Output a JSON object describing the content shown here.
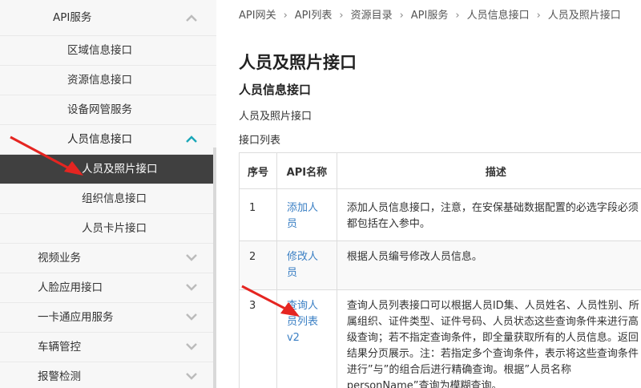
{
  "sidebar": {
    "items": [
      {
        "label": "API服务",
        "level": 2,
        "chevron": "chevron-up"
      },
      {
        "label": "区域信息接口",
        "level": 3
      },
      {
        "label": "资源信息接口",
        "level": 3
      },
      {
        "label": "设备网管服务",
        "level": 3
      },
      {
        "label": "人员信息接口",
        "level": 3,
        "chevron": "chevron-up",
        "open": true
      },
      {
        "label": "人员及照片接口",
        "level": 4,
        "active": true
      },
      {
        "label": "组织信息接口",
        "level": 4
      },
      {
        "label": "人员卡片接口",
        "level": 4
      },
      {
        "label": "视频业务",
        "level": 1,
        "chevron": "chevron-down"
      },
      {
        "label": "人脸应用接口",
        "level": 1,
        "chevron": "chevron-down"
      },
      {
        "label": "一卡通应用服务",
        "level": 1,
        "chevron": "chevron-down"
      },
      {
        "label": "车辆管控",
        "level": 1,
        "chevron": "chevron-down"
      },
      {
        "label": "报警检测",
        "level": 1,
        "chevron": "chevron-down"
      }
    ]
  },
  "breadcrumb": [
    "API网关",
    "API列表",
    "资源目录",
    "API服务",
    "人员信息接口",
    "人员及照片接口"
  ],
  "main": {
    "page_title": "人员及照片接口",
    "sub_title": "人员信息接口",
    "description": "人员及照片接口",
    "list_title": "接口列表"
  },
  "table": {
    "headers": [
      "序号",
      "API名称",
      "描述"
    ],
    "rows": [
      {
        "no": "1",
        "name": "添加人员",
        "desc": "添加人员信息接口，注意，在安保基础数据配置的必选字段必须都包括在入参中。"
      },
      {
        "no": "2",
        "name": "修改人员",
        "desc": "根据人员编号修改人员信息。"
      },
      {
        "no": "3",
        "name": "查询人员列表v2",
        "desc": "查询人员列表接口可以根据人员ID集、人员姓名、人员性别、所属组织、证件类型、证件号码、人员状态这些查询条件来进行高级查询；若不指定查询条件，即全量获取所有的人员信息。返回结果分页展示。注：若指定多个查询条件，表示将这些查询条件进行”与”的组合后进行精确查询。根据”人员名称personName”查询为模糊查询。"
      }
    ]
  },
  "colors": {
    "active_bg": "#404040",
    "link": "#3a7fc4",
    "accent": "#1aa7b8",
    "arrow": "#e52521"
  }
}
